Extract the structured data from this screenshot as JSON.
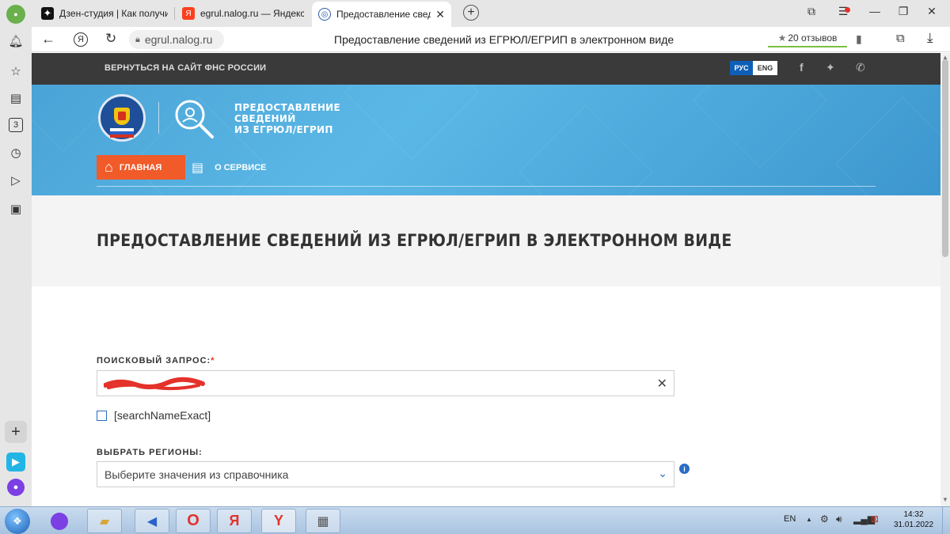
{
  "browser": {
    "tabs": [
      {
        "title": "Дзен-студия | Как получи"
      },
      {
        "title": "egrul.nalog.ru — Яндекс: н"
      },
      {
        "title": "Предоставление сведе"
      }
    ],
    "url": "egrul.nalog.ru",
    "page_title": "Предоставление сведений из ЕГРЮЛ/ЕГРИП в электронном виде",
    "reviews": "20 отзывов",
    "sidebar_badge": "3"
  },
  "site": {
    "back_link": "ВЕРНУТЬСЯ НА САЙТ ФНС РОССИИ",
    "lang_ru": "РУС",
    "lang_en": "ENG",
    "service_title_1": "ПРЕДОСТАВЛЕНИЕ",
    "service_title_2": "СВЕДЕНИЙ",
    "service_title_3": "ИЗ ЕГРЮЛ/ЕГРИП",
    "nav_home": "ГЛАВНАЯ",
    "nav_about": "О СЕРВИСЕ",
    "page_heading": "ПРЕДОСТАВЛЕНИЕ СВЕДЕНИЙ ИЗ ЕГРЮЛ/ЕГРИП В ЭЛЕКТРОННОМ ВИДЕ",
    "search_label": "ПОИСКОВЫЙ ЗАПРОС:",
    "required_mark": "*",
    "exact_checkbox_label": "[searchNameExact]",
    "regions_label": "ВЫБРАТЬ РЕГИОНЫ:",
    "regions_placeholder": "Выберите значения из справочника"
  },
  "taskbar": {
    "lang": "EN",
    "time": "14:32",
    "date": "31.01.2022"
  },
  "colors": {
    "accent_orange": "#f15a29",
    "header_blue": "#4aa3d6",
    "dark_nav": "#3a3a3a",
    "lang_active": "#0e5fb8"
  }
}
